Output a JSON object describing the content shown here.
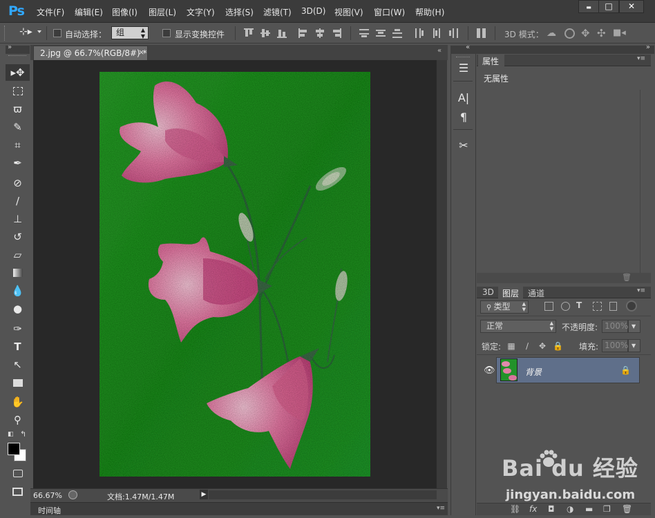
{
  "app": {
    "logo": "Ps"
  },
  "menu": [
    "文件(F)",
    "编辑(E)",
    "图像(I)",
    "图层(L)",
    "文字(Y)",
    "选择(S)",
    "滤镜(T)",
    "3D(D)",
    "视图(V)",
    "窗口(W)",
    "帮助(H)"
  ],
  "window_controls": {
    "minimize": "▬",
    "maximize": "□",
    "close": "✕"
  },
  "options": {
    "auto_select_label": "自动选择：",
    "auto_select_value": "组",
    "show_transform_label": "显示变换控件",
    "mode_3d_label": "3D 模式："
  },
  "document": {
    "tab_title": "2.jpg @ 66.7%(RGB/8#) *",
    "tab_close": "×",
    "zoom": "66.67%",
    "doc_info": "文档:1.47M/1.47M"
  },
  "timeline": {
    "label": "时间轴"
  },
  "properties": {
    "tab": "属性",
    "empty_message": "无属性"
  },
  "layers": {
    "tabs": [
      "3D",
      "图层",
      "通道"
    ],
    "filter_kind": "类型",
    "blend_mode": "正常",
    "opacity_label": "不透明度:",
    "opacity_value": "100%",
    "lock_label": "锁定:",
    "fill_label": "填充:",
    "fill_value": "100%",
    "items": [
      {
        "name": "背景",
        "visible": true,
        "locked": true
      }
    ]
  },
  "colors": {
    "foreground": "#000000",
    "background": "#ffffff",
    "accent": "#31a8ff"
  },
  "watermark": {
    "brand": "Bai du 经验",
    "url": "jingyan.baidu.com"
  }
}
